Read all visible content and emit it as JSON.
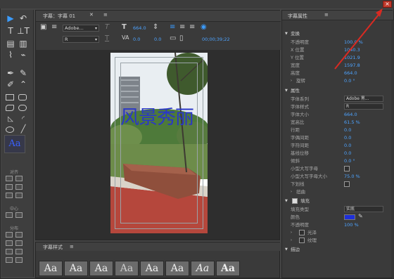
{
  "window": {
    "close_label": "×"
  },
  "editor": {
    "tab_title": "字幕：字幕 01",
    "tab_close": "✕",
    "tab_menu": "≡",
    "font_family": "Adobe...",
    "font_style": "R",
    "font_size": "664.0",
    "kerning": "0.0",
    "leading": "0.0",
    "timecode": "00;00;39;22",
    "title_text": "风景秀丽"
  },
  "styles_panel": {
    "title": "字幕样式",
    "menu": "≡",
    "samples": [
      "Aa",
      "Aa",
      "Aa",
      "Aa",
      "Aa",
      "Aa",
      "Aa",
      "Aa"
    ]
  },
  "tools": {
    "selected_swatch": "Aa",
    "labels": {
      "align": "对齐",
      "center": "中心",
      "distribute": "分布"
    }
  },
  "properties": {
    "title": "字幕属性",
    "menu": "≡",
    "transform": {
      "label": "变换",
      "rows": [
        {
          "label": "不透明度",
          "value": "100.0 %"
        },
        {
          "label": "X 位置",
          "value": "1040.3"
        },
        {
          "label": "Y 位置",
          "value": "1021.9"
        },
        {
          "label": "宽度",
          "value": "1597.8"
        },
        {
          "label": "高度",
          "value": "664.0"
        },
        {
          "label": "旋转",
          "value": "0.0 °"
        }
      ]
    },
    "attributes": {
      "label": "属性",
      "rows": [
        {
          "label": "字体系列",
          "value": "Adobe 黑..."
        },
        {
          "label": "字体样式",
          "value": "R"
        },
        {
          "label": "字体大小",
          "value": "664.0"
        },
        {
          "label": "宽高比",
          "value": "61.5 %"
        },
        {
          "label": "行距",
          "value": "0.0"
        },
        {
          "label": "字偶间距",
          "value": "0.0"
        },
        {
          "label": "字符间距",
          "value": "0.0"
        },
        {
          "label": "基线位移",
          "value": "0.0"
        },
        {
          "label": "倾斜",
          "value": "0.0 °"
        },
        {
          "label": "小型大写字母",
          "value": ""
        },
        {
          "label": "小型大写字母大小",
          "value": "75.0 %"
        },
        {
          "label": "下划线",
          "value": ""
        },
        {
          "label": "扭曲",
          "value": ""
        }
      ]
    },
    "fill": {
      "label": "填充",
      "rows": [
        {
          "label": "填充类型",
          "value": "实底"
        },
        {
          "label": "颜色",
          "value": ""
        },
        {
          "label": "不透明度",
          "value": "100 %"
        },
        {
          "label": "光泽",
          "value": ""
        },
        {
          "label": "纹理",
          "value": ""
        }
      ]
    },
    "stroke": {
      "label": "描边"
    },
    "colors": {
      "fill_color": "#1e2fd8",
      "accent": "#4da3ff"
    }
  }
}
